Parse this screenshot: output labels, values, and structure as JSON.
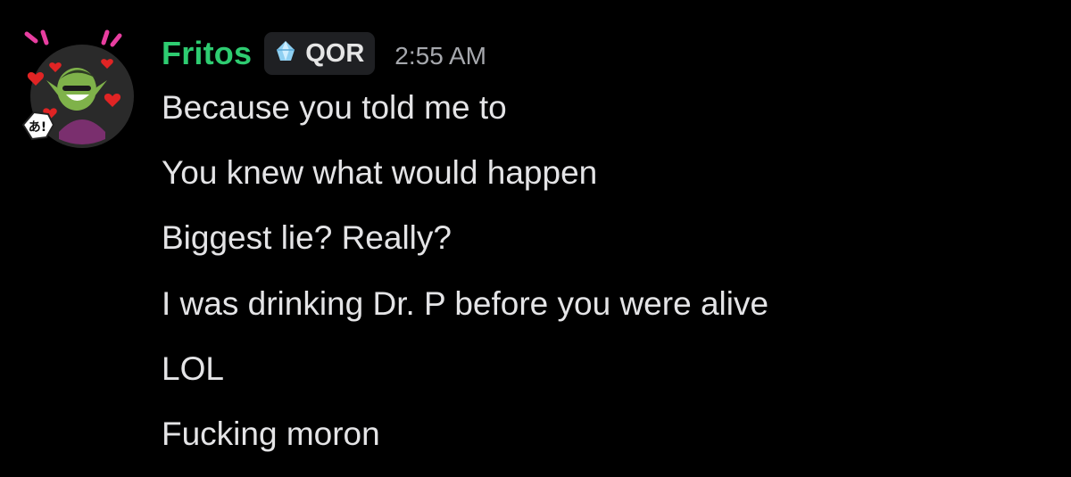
{
  "message": {
    "username": "Fritos",
    "username_color": "#2ecc71",
    "tag": {
      "icon": "crystal-icon",
      "label": "QOR"
    },
    "timestamp": "2:55 AM",
    "lines": [
      "Because you told me to",
      "You knew what would happen",
      "Biggest lie? Really?",
      "I was drinking Dr. P before you were alive",
      "LOL",
      "Fucking moron"
    ],
    "avatar_decoration_text": "あ!"
  }
}
